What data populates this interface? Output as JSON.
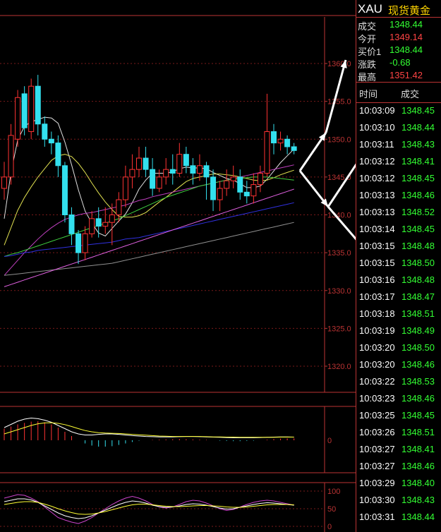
{
  "header": {
    "symbol": "XAU",
    "name": "现货黄金"
  },
  "quote": [
    {
      "label": "成交",
      "value": "1348.44",
      "color": "#33ff33"
    },
    {
      "label": "今开",
      "value": "1349.14",
      "color": "#ff4444"
    },
    {
      "label": "买价1",
      "value": "1348.44",
      "color": "#33ff33"
    },
    {
      "label": "涨跌",
      "value": "-0.68",
      "color": "#33ff33"
    },
    {
      "label": "最高",
      "value": "1351.42",
      "color": "#ff4444"
    }
  ],
  "ticks_header": {
    "time": "时间",
    "price": "成交"
  },
  "ticks": [
    [
      "10:03:09",
      "1348.45"
    ],
    [
      "10:03:10",
      "1348.44"
    ],
    [
      "10:03:11",
      "1348.43"
    ],
    [
      "10:03:12",
      "1348.41"
    ],
    [
      "10:03:12",
      "1348.45"
    ],
    [
      "10:03:13",
      "1348.46"
    ],
    [
      "10:03:13",
      "1348.52"
    ],
    [
      "10:03:14",
      "1348.45"
    ],
    [
      "10:03:15",
      "1348.48"
    ],
    [
      "10:03:15",
      "1348.50"
    ],
    [
      "10:03:16",
      "1348.48"
    ],
    [
      "10:03:17",
      "1348.47"
    ],
    [
      "10:03:18",
      "1348.51"
    ],
    [
      "10:03:19",
      "1348.49"
    ],
    [
      "10:03:20",
      "1348.50"
    ],
    [
      "10:03:20",
      "1348.46"
    ],
    [
      "10:03:22",
      "1348.53"
    ],
    [
      "10:03:23",
      "1348.46"
    ],
    [
      "10:03:25",
      "1348.45"
    ],
    [
      "10:03:26",
      "1348.51"
    ],
    [
      "10:03:27",
      "1348.41"
    ],
    [
      "10:03:27",
      "1348.46"
    ],
    [
      "10:03:29",
      "1348.40"
    ],
    [
      "10:03:30",
      "1348.43"
    ],
    [
      "10:03:31",
      "1348.44"
    ]
  ],
  "chart_data": [
    {
      "type": "candlestick",
      "y_ticks": [
        "1360.0",
        "1355.0",
        "1350.0",
        "1345.0",
        "1340.0",
        "1335.0",
        "1330.0",
        "1325.0",
        "1320.0"
      ],
      "y_tick_values": [
        1360,
        1355,
        1350,
        1345,
        1340,
        1335,
        1330,
        1325,
        1320
      ],
      "ylim": [
        1316.5,
        1366.5
      ],
      "up_color": "#ff3333",
      "down_color": "#33e0ee",
      "candles": [
        [
          1343.5,
          1345.0,
          1342.0,
          1347.0
        ],
        [
          1345.0,
          1350.5,
          1344.0,
          1352.0
        ],
        [
          1350.0,
          1355.5,
          1349.0,
          1356.5
        ],
        [
          1356.0,
          1351.5,
          1350.5,
          1357.0
        ],
        [
          1351.0,
          1357.0,
          1350.0,
          1358.0
        ],
        [
          1357.0,
          1352.0,
          1350.5,
          1358.5
        ],
        [
          1352.0,
          1350.0,
          1349.0,
          1353.0
        ],
        [
          1350.0,
          1349.5,
          1348.0,
          1351.0
        ],
        [
          1349.5,
          1346.5,
          1345.0,
          1350.5
        ],
        [
          1346.5,
          1340.0,
          1339.0,
          1347.0
        ],
        [
          1340.0,
          1337.5,
          1336.0,
          1341.0
        ],
        [
          1337.5,
          1335.0,
          1333.5,
          1338.0
        ],
        [
          1335.0,
          1337.5,
          1334.0,
          1338.5
        ],
        [
          1337.5,
          1339.5,
          1337.0,
          1340.5
        ],
        [
          1339.5,
          1338.5,
          1337.0,
          1341.0
        ],
        [
          1338.5,
          1339.0,
          1337.5,
          1341.0
        ],
        [
          1339.0,
          1340.0,
          1336.0,
          1341.5
        ],
        [
          1340.0,
          1342.0,
          1339.0,
          1343.0
        ],
        [
          1342.0,
          1345.0,
          1341.0,
          1346.5
        ],
        [
          1345.0,
          1346.0,
          1343.5,
          1348.0
        ],
        [
          1346.0,
          1347.5,
          1345.0,
          1349.0
        ],
        [
          1347.5,
          1346.0,
          1345.0,
          1349.0
        ],
        [
          1346.0,
          1343.5,
          1342.5,
          1347.5
        ],
        [
          1343.5,
          1345.0,
          1343.0,
          1346.0
        ],
        [
          1345.0,
          1346.0,
          1344.0,
          1347.5
        ],
        [
          1346.0,
          1345.5,
          1344.0,
          1348.0
        ],
        [
          1345.5,
          1348.0,
          1345.0,
          1349.5
        ],
        [
          1348.0,
          1346.5,
          1345.5,
          1349.0
        ],
        [
          1346.5,
          1345.5,
          1344.0,
          1347.5
        ],
        [
          1345.5,
          1346.5,
          1344.5,
          1348.0
        ],
        [
          1346.5,
          1345.0,
          1342.0,
          1347.0
        ],
        [
          1345.0,
          1342.0,
          1340.5,
          1346.0
        ],
        [
          1342.0,
          1343.5,
          1340.5,
          1344.5
        ],
        [
          1343.5,
          1344.5,
          1342.5,
          1346.0
        ],
        [
          1344.5,
          1345.0,
          1343.5,
          1346.5
        ],
        [
          1345.0,
          1343.0,
          1342.0,
          1346.0
        ],
        [
          1343.0,
          1342.5,
          1341.5,
          1344.5
        ],
        [
          1342.5,
          1344.0,
          1341.5,
          1345.5
        ],
        [
          1344.0,
          1345.5,
          1343.0,
          1346.5
        ],
        [
          1345.5,
          1351.0,
          1345.0,
          1356.0
        ],
        [
          1351.0,
          1349.5,
          1348.0,
          1352.0
        ],
        [
          1349.5,
          1350.0,
          1348.5,
          1351.0
        ],
        [
          1350.0,
          1349.0,
          1348.0,
          1350.5
        ],
        [
          1349.0,
          1348.5,
          1348.0,
          1349.5
        ]
      ],
      "ma_lines": [
        {
          "color": "#e0e0e0",
          "values": [
            1339.5,
            1345.6,
            1349.9,
            1351.7,
            1352.3,
            1352.6,
            1352.9,
            1352.8,
            1352.1,
            1349.6,
            1346.6,
            1343.3,
            1340.5,
            1338.9,
            1337.6,
            1337.2,
            1338.2,
            1339.2,
            1340.1,
            1341.6,
            1343.4,
            1344.6,
            1345.5,
            1345.5,
            1345.5,
            1345.7,
            1346.1,
            1346.3,
            1346.2,
            1346.2,
            1346.1,
            1345.6,
            1345.2,
            1344.8,
            1344.6,
            1344.1,
            1343.6,
            1343.6,
            1343.8,
            1344.7,
            1345.8,
            1346.9,
            1347.8,
            1348.7
          ]
        },
        {
          "color": "#e0e050",
          "values": [
            1336.0,
            1338.3,
            1340.6,
            1342.3,
            1343.7,
            1345.0,
            1346.1,
            1347.2,
            1347.8,
            1348.0,
            1347.7,
            1346.8,
            1345.6,
            1344.2,
            1342.9,
            1341.7,
            1340.7,
            1339.8,
            1339.7,
            1339.7,
            1339.9,
            1340.3,
            1341.0,
            1341.7,
            1342.3,
            1343.0,
            1343.7,
            1344.4,
            1344.8,
            1345.0,
            1345.2,
            1345.4,
            1345.4,
            1345.3,
            1345.2,
            1345.0,
            1344.8,
            1344.6,
            1344.5,
            1344.6,
            1344.9,
            1345.3,
            1345.6,
            1345.9
          ]
        },
        {
          "color": "#c040c0",
          "values": [
            1332.0,
            1333.0,
            1334.0,
            1335.0,
            1335.9,
            1336.8,
            1337.6,
            1338.3,
            1338.9,
            1339.4,
            1339.7,
            1340.0,
            1340.2,
            1340.3,
            1340.5,
            1340.7,
            1340.9,
            1341.1,
            1341.3,
            1341.6,
            1341.9,
            1342.1,
            1342.4,
            1342.6,
            1342.8,
            1343.0,
            1343.2,
            1343.4,
            1343.6,
            1343.8,
            1344.0,
            1344.2,
            1344.4,
            1344.6,
            1344.8,
            1345.0,
            1345.2,
            1345.4,
            1345.6,
            1345.8,
            1346.0,
            1346.2,
            1346.4,
            1346.6
          ]
        },
        {
          "color": "#40d040",
          "values": [
            1334.5,
            1334.8,
            1335.0,
            1335.3,
            1335.6,
            1335.9,
            1336.2,
            1336.5,
            1336.8,
            1337.1,
            1337.4,
            1337.7,
            1338.0,
            1338.3,
            1338.6,
            1338.9,
            1339.2,
            1339.5,
            1339.9,
            1340.3,
            1340.7,
            1341.1,
            1341.5,
            1341.9,
            1342.3,
            1342.6,
            1342.9,
            1343.2,
            1343.5,
            1343.8,
            1344.0,
            1344.2,
            1344.4,
            1344.6,
            1344.7,
            1344.8,
            1344.9,
            1345.0,
            1345.0,
            1345.0,
            1344.9,
            1344.8,
            1344.7,
            1344.6
          ]
        },
        {
          "color": "#3030e0",
          "values": [
            1334.5,
            1334.6,
            1334.8,
            1335.0,
            1335.1,
            1335.3,
            1335.4,
            1335.5,
            1335.6,
            1335.7,
            1335.8,
            1335.9,
            1336.0,
            1336.1,
            1336.2,
            1336.3,
            1336.4,
            1336.6,
            1336.8,
            1336.9,
            1337.0,
            1337.2,
            1337.4,
            1337.6,
            1337.8,
            1338.0,
            1338.2,
            1338.4,
            1338.6,
            1338.8,
            1339.0,
            1339.2,
            1339.4,
            1339.6,
            1339.8,
            1340.0,
            1340.2,
            1340.4,
            1340.6,
            1340.8,
            1341.0,
            1341.2,
            1341.4,
            1341.6
          ]
        },
        {
          "color": "#909090",
          "values": [
            1332.0,
            1332.1,
            1332.2,
            1332.3,
            1332.4,
            1332.5,
            1332.6,
            1332.7,
            1332.8,
            1332.9,
            1333.0,
            1333.1,
            1333.2,
            1333.3,
            1333.4,
            1333.5,
            1333.6,
            1333.8,
            1334.0,
            1334.2,
            1334.4,
            1334.6,
            1334.8,
            1335.0,
            1335.2,
            1335.4,
            1335.6,
            1335.8,
            1336.0,
            1336.2,
            1336.4,
            1336.6,
            1336.8,
            1337.0,
            1337.2,
            1337.4,
            1337.6,
            1337.8,
            1338.0,
            1338.2,
            1338.4,
            1338.6,
            1338.8,
            1339.0
          ]
        },
        {
          "color": "#e060e0",
          "values": [
            1330.5,
            1330.8,
            1331.1,
            1331.4,
            1331.7,
            1332.0,
            1332.3,
            1332.6,
            1332.9,
            1333.2,
            1333.5,
            1333.8,
            1334.1,
            1334.4,
            1334.7,
            1335.0,
            1335.3,
            1335.6,
            1335.9,
            1336.2,
            1336.5,
            1336.8,
            1337.1,
            1337.4,
            1337.7,
            1338.0,
            1338.3,
            1338.6,
            1338.9,
            1339.2,
            1339.5,
            1339.8,
            1340.1,
            1340.4,
            1340.7,
            1341.0,
            1341.3,
            1341.6,
            1341.9,
            1342.2,
            1342.5,
            1342.8,
            1343.1,
            1343.4
          ]
        }
      ]
    },
    {
      "type": "bar",
      "y_ticks": [
        "0"
      ],
      "ylim": [
        -1.5,
        1.5
      ],
      "macd": [
        0.55,
        0.65,
        0.75,
        0.82,
        0.88,
        0.9,
        0.85,
        0.75,
        0.6,
        0.4,
        0.2,
        0.0,
        -0.15,
        -0.25,
        -0.3,
        -0.3,
        -0.28,
        -0.22,
        -0.15,
        -0.08,
        -0.02,
        0.0,
        0.02,
        0.03,
        0.04,
        0.05,
        0.06,
        0.05,
        0.04,
        0.03,
        0.02,
        0.0,
        -0.02,
        -0.03,
        -0.04,
        -0.04,
        -0.03,
        -0.02,
        0.0,
        0.03,
        0.06,
        0.08,
        0.09,
        0.09
      ],
      "lines": [
        {
          "color": "#ffffff",
          "values": [
            0.6,
            0.75,
            0.9,
            1.0,
            1.05,
            1.02,
            0.95,
            0.85,
            0.7,
            0.55,
            0.4,
            0.3,
            0.25,
            0.25,
            0.28,
            0.3,
            0.3,
            0.28,
            0.25,
            0.22,
            0.2,
            0.18,
            0.17,
            0.16,
            0.16,
            0.16,
            0.17,
            0.18,
            0.18,
            0.17,
            0.16,
            0.15,
            0.14,
            0.13,
            0.12,
            0.12,
            0.12,
            0.12,
            0.13,
            0.14,
            0.15,
            0.16,
            0.16,
            0.15
          ]
        },
        {
          "color": "#ffff33",
          "values": [
            0.3,
            0.4,
            0.5,
            0.6,
            0.7,
            0.78,
            0.82,
            0.83,
            0.8,
            0.74,
            0.65,
            0.55,
            0.46,
            0.4,
            0.36,
            0.34,
            0.33,
            0.32,
            0.3,
            0.28,
            0.26,
            0.24,
            0.22,
            0.2,
            0.19,
            0.18,
            0.18,
            0.18,
            0.18,
            0.18,
            0.17,
            0.16,
            0.16,
            0.15,
            0.15,
            0.14,
            0.14,
            0.14,
            0.14,
            0.14,
            0.14,
            0.15,
            0.15,
            0.15
          ]
        }
      ]
    },
    {
      "type": "line",
      "y_ticks": [
        "100",
        "50",
        "0"
      ],
      "y_tick_values": [
        100,
        50,
        0
      ],
      "ylim": [
        0,
        100
      ],
      "lines": [
        {
          "color": "#cc44cc",
          "values": [
            80,
            85,
            90,
            88,
            80,
            70,
            55,
            40,
            25,
            18,
            12,
            8,
            15,
            25,
            38,
            50,
            62,
            72,
            80,
            85,
            80,
            72,
            62,
            55,
            52,
            55,
            62,
            70,
            74,
            72,
            66,
            58,
            50,
            45,
            48,
            55,
            62,
            68,
            72,
            74,
            72,
            68,
            64,
            60
          ]
        },
        {
          "color": "#ffffff",
          "values": [
            70,
            74,
            78,
            78,
            75,
            68,
            58,
            48,
            38,
            30,
            25,
            22,
            24,
            30,
            38,
            46,
            54,
            62,
            68,
            72,
            70,
            66,
            60,
            56,
            54,
            55,
            58,
            62,
            64,
            63,
            60,
            56,
            52,
            49,
            50,
            54,
            58,
            62,
            65,
            67,
            66,
            64,
            62,
            60
          ]
        },
        {
          "color": "#ffff33",
          "values": [
            62,
            65,
            68,
            70,
            70,
            68,
            63,
            57,
            50,
            44,
            39,
            35,
            34,
            35,
            38,
            42,
            47,
            52,
            57,
            61,
            63,
            63,
            61,
            59,
            57,
            56,
            56,
            57,
            58,
            59,
            59,
            58,
            57,
            55,
            54,
            54,
            55,
            57,
            59,
            61,
            62,
            62,
            62,
            61
          ]
        }
      ]
    }
  ]
}
